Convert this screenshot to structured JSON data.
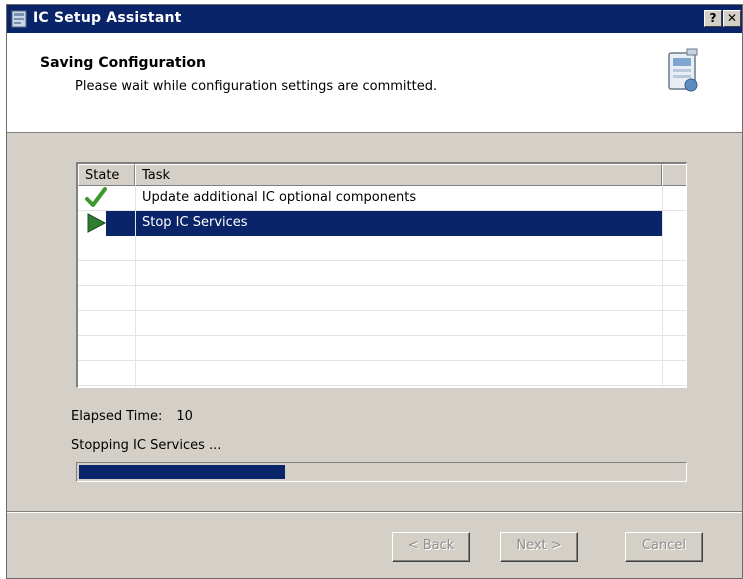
{
  "window": {
    "title": "IC Setup Assistant",
    "help_label": "?",
    "close_label": "✕"
  },
  "header": {
    "title": "Saving Configuration",
    "subtitle": "Please wait while configuration settings are committed."
  },
  "task_list": {
    "columns": [
      "State",
      "Task"
    ],
    "rows": [
      {
        "state": "check-icon",
        "task": "Update additional IC optional components",
        "selected": false
      },
      {
        "state": "play-arrow-icon",
        "task": "Stop IC Services",
        "selected": true
      }
    ]
  },
  "elapsed": {
    "label": "Elapsed Time:",
    "value": "10"
  },
  "status_text": "Stopping IC Services ...",
  "progress": {
    "fraction": 0.34
  },
  "buttons": {
    "back": "< Back",
    "next": "Next >",
    "cancel": "Cancel"
  },
  "colors": {
    "title_bar": "#0a246a",
    "selection": "#0a246a",
    "dialog_face": "#d4d0c8",
    "check_green": "#3a9a2a",
    "arrow_green": "#2e7d32"
  }
}
